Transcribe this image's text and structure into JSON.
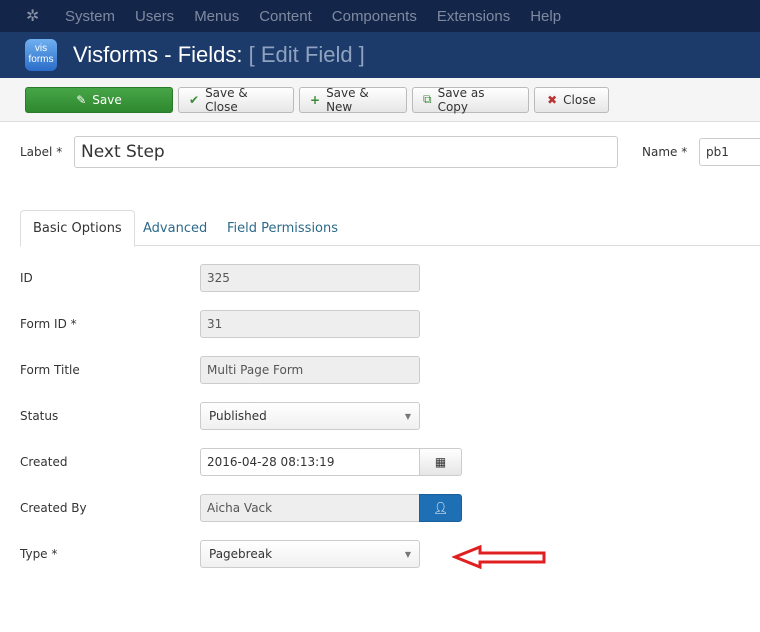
{
  "nav": {
    "items": [
      "System",
      "Users",
      "Menus",
      "Content",
      "Components",
      "Extensions",
      "Help"
    ]
  },
  "header": {
    "title": "Visforms - Fields:",
    "subtitle": "[ Edit Field ]",
    "logo_text": "vis forms"
  },
  "toolbar": {
    "save": "Save",
    "save_close": "Save & Close",
    "save_new": "Save & New",
    "save_copy": "Save as Copy",
    "close": "Close"
  },
  "top": {
    "label_label": "Label *",
    "label_value": "Next Step",
    "name_label": "Name *",
    "name_value": "pb1"
  },
  "tabs": [
    "Basic Options",
    "Advanced",
    "Field Permissions"
  ],
  "fields": {
    "id": {
      "label": "ID",
      "value": "325"
    },
    "form_id": {
      "label": "Form ID *",
      "value": "31"
    },
    "form_title": {
      "label": "Form Title",
      "value": "Multi Page Form"
    },
    "status": {
      "label": "Status",
      "value": "Published"
    },
    "created": {
      "label": "Created",
      "value": "2016-04-28 08:13:19"
    },
    "created_by": {
      "label": "Created By",
      "value": "Aicha Vack"
    },
    "type": {
      "label": "Type *",
      "value": "Pagebreak"
    }
  },
  "colors": {
    "nav": "#14254a",
    "header": "#1c3a6a",
    "save": "#3c9a3c",
    "annotation_arrow": "#e02020",
    "user_button": "#1f6fb5"
  }
}
